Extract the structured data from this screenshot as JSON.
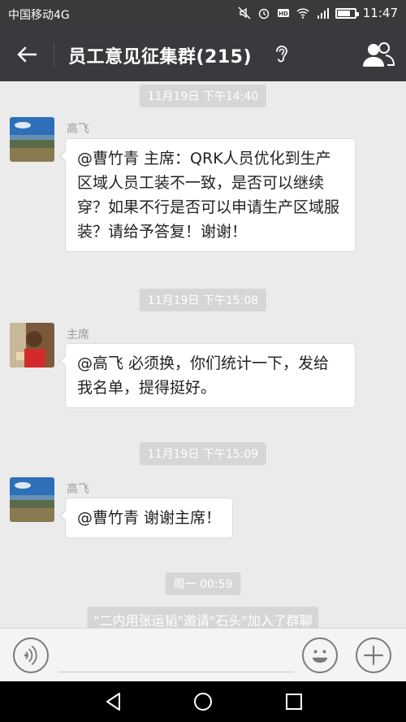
{
  "status": {
    "carrier": "中国移动4G",
    "time": "11:47"
  },
  "header": {
    "title": "员工意见征集群(215)"
  },
  "messages": [
    {
      "timestamp": "11月19日 下午14:40",
      "sender": "高飞",
      "text": "@曹竹青 主席：QRK人员优化到生产区域人员工装不一致，是否可以继续穿？如果不行是否可以申请生产区域服装？请给予答复！谢谢！"
    },
    {
      "timestamp": "11月19日 下午15:08",
      "sender": "主席",
      "text": "@高飞 必须换，你们统计一下，发给我名单，提得挺好。"
    },
    {
      "timestamp": "11月19日 下午15:09",
      "sender": "高飞",
      "text": "@曹竹青 谢谢主席！"
    }
  ],
  "system": {
    "timestamp": "周一 00:59",
    "notice": "\"二内用张运韬\"邀请\"石头\"加入了群聊"
  },
  "input": {
    "placeholder": ""
  },
  "colors": {
    "titlebar": "#393a3e",
    "statusbar": "#3a3a3a",
    "chat_bg": "#ebebeb",
    "timestamp_bg": "#d6d6d6"
  },
  "icons": [
    "back-arrow-icon",
    "ear-icon",
    "group-members-icon",
    "voice-icon",
    "emoji-icon",
    "plus-icon",
    "nav-back-icon",
    "nav-home-icon",
    "nav-recent-icon"
  ]
}
